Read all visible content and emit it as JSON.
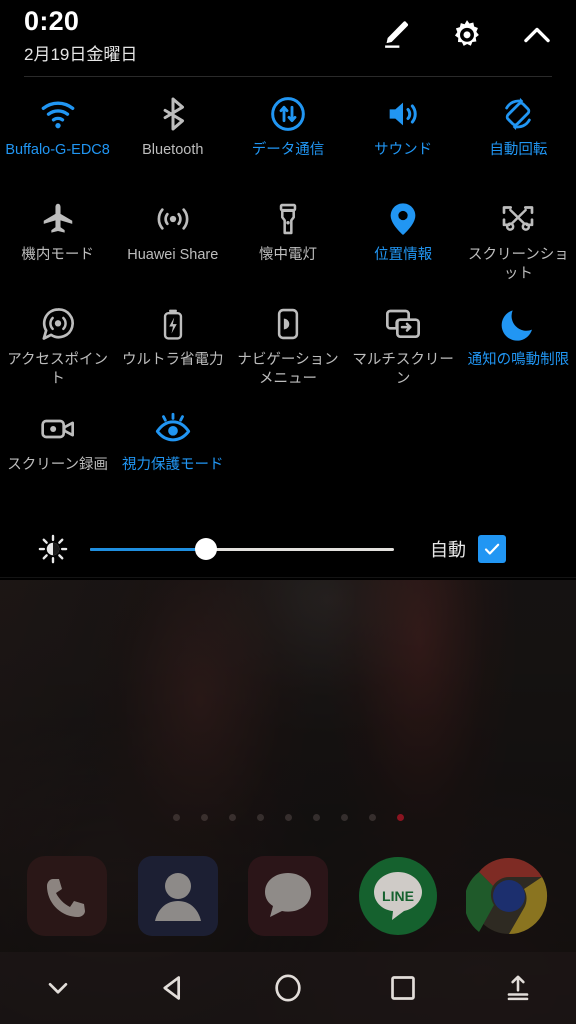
{
  "status": {
    "time": "0:20",
    "date": "2月19日金曜日"
  },
  "header": {
    "edit_label": "編集",
    "settings_label": "設定",
    "collapse_label": "閉じる",
    "icons": [
      "edit-pencil-icon",
      "gear-icon",
      "chevron-up-icon"
    ]
  },
  "colors": {
    "accent": "#2196f3",
    "inactive": "#bdbdbd",
    "panel_background": "#000000",
    "slider_fill": "#1f8fe0",
    "page_dot_active": "#8a1420"
  },
  "tiles": [
    {
      "label": "Buffalo-G-EDC8",
      "icon": "wifi-icon",
      "state": "on"
    },
    {
      "label": "Bluetooth",
      "icon": "bluetooth-icon",
      "state": "off"
    },
    {
      "label": "データ通信",
      "icon": "mobile-data-icon",
      "state": "on"
    },
    {
      "label": "サウンド",
      "icon": "sound-icon",
      "state": "on"
    },
    {
      "label": "自動回転",
      "icon": "auto-rotate-icon",
      "state": "on"
    },
    {
      "label": "機内モード",
      "icon": "airplane-icon",
      "state": "off"
    },
    {
      "label": "Huawei Share",
      "icon": "huawei-share-icon",
      "state": "off"
    },
    {
      "label": "懐中電灯",
      "icon": "flashlight-icon",
      "state": "off"
    },
    {
      "label": "位置情報",
      "icon": "location-pin-icon",
      "state": "on"
    },
    {
      "label": "スクリーンショット",
      "icon": "screenshot-icon",
      "state": "off"
    },
    {
      "label": "アクセスポイント",
      "icon": "hotspot-icon",
      "state": "off"
    },
    {
      "label": "ウルトラ省電力",
      "icon": "battery-saver-icon",
      "state": "off"
    },
    {
      "label": "ナビゲーションメニュー",
      "icon": "navigation-menu-icon",
      "state": "off"
    },
    {
      "label": "マルチスクリーン",
      "icon": "multi-screen-icon",
      "state": "off"
    },
    {
      "label": "通知の鳴動制限",
      "icon": "moon-icon",
      "state": "on"
    },
    {
      "label": "スクリーン録画",
      "icon": "screen-record-icon",
      "state": "off"
    },
    {
      "label": "視力保護モード",
      "icon": "eye-comfort-icon",
      "state": "on"
    }
  ],
  "brightness": {
    "icon": "brightness-icon",
    "value_percent": 38,
    "auto_label": "自動",
    "auto_checked": true
  },
  "home": {
    "page_dots": {
      "count": 9,
      "active_index": 8
    },
    "dock": [
      {
        "label": "電話",
        "icon": "phone-icon"
      },
      {
        "label": "連絡先",
        "icon": "contacts-icon"
      },
      {
        "label": "メッセージ",
        "icon": "messages-icon"
      },
      {
        "label": "LINE",
        "icon": "line-icon"
      },
      {
        "label": "Chrome",
        "icon": "chrome-icon"
      }
    ]
  },
  "navbar": [
    {
      "label": "パネルを閉じる",
      "icon": "chevron-down-icon"
    },
    {
      "label": "戻る",
      "icon": "back-triangle-icon"
    },
    {
      "label": "ホーム",
      "icon": "home-circle-icon"
    },
    {
      "label": "最近のアプリ",
      "icon": "recents-square-icon"
    },
    {
      "label": "ナビゲーションドック",
      "icon": "eject-icon"
    }
  ]
}
